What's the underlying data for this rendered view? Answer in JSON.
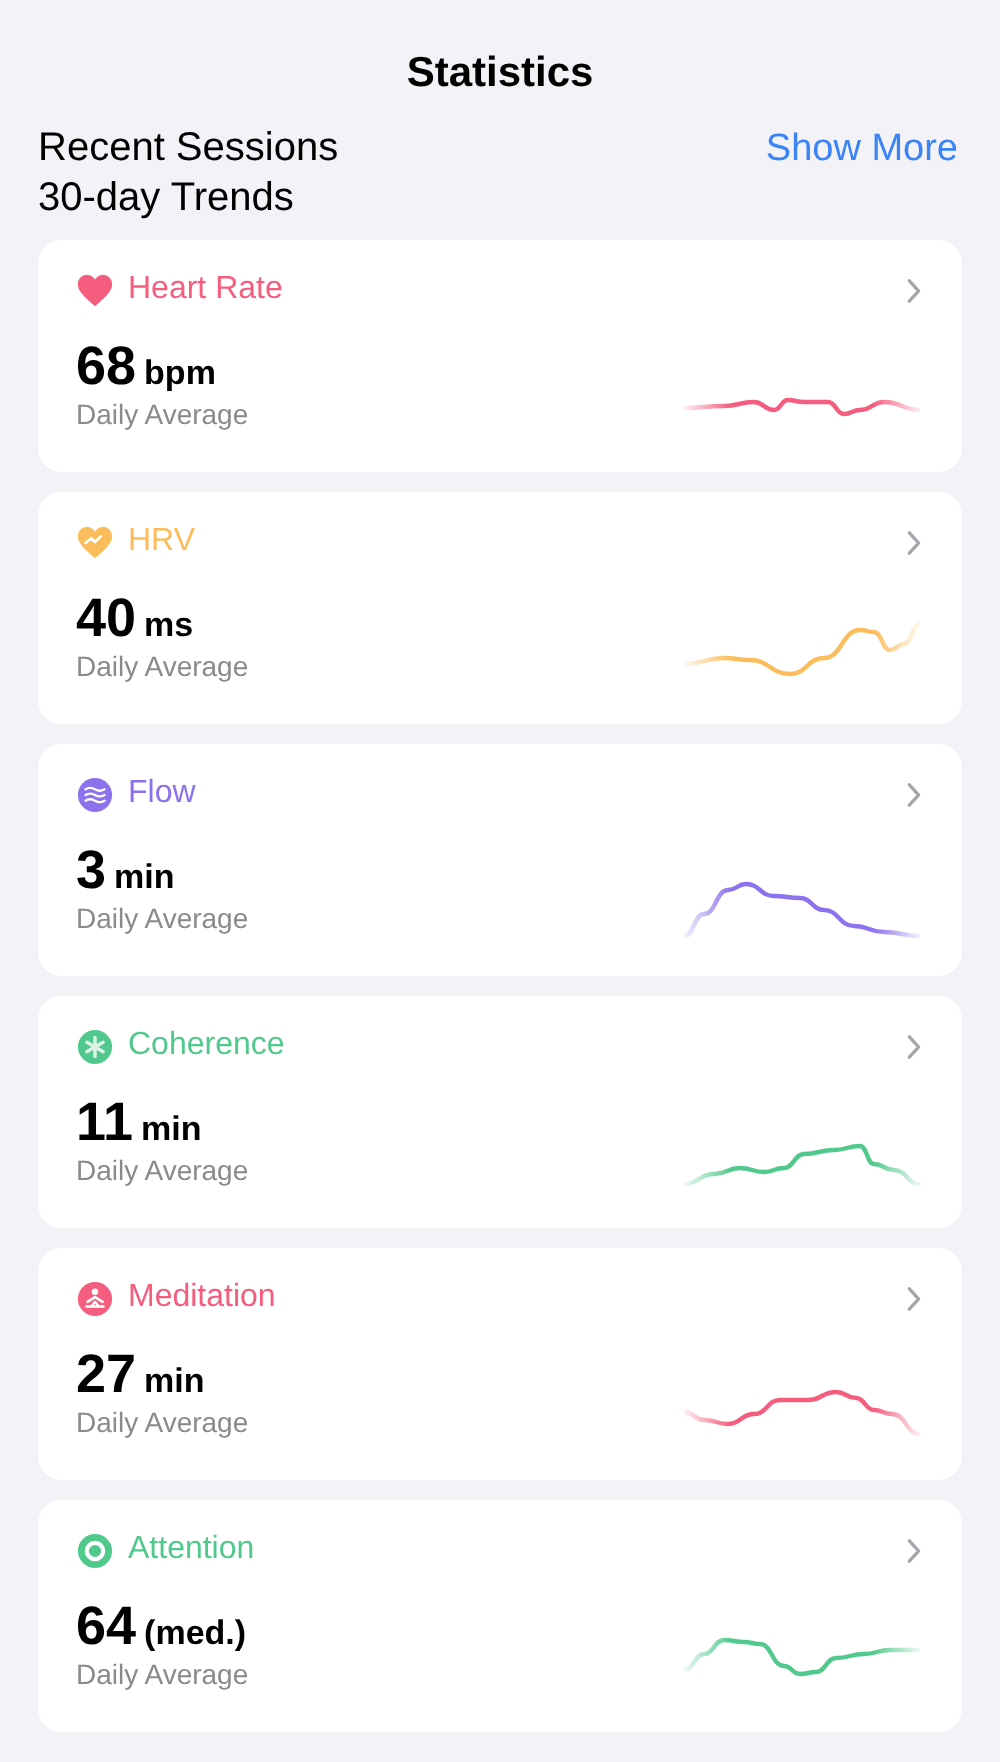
{
  "title": "Statistics",
  "recent_sessions": {
    "heading": "Recent Sessions",
    "link": "Show More"
  },
  "trends_heading": "30-day Trends",
  "cards": [
    {
      "kind": "heart",
      "title": "Heart Rate",
      "color": "#f45d7e",
      "value": "68",
      "unit": "bpm",
      "caption": "Daily Average"
    },
    {
      "kind": "hrv",
      "title": "HRV",
      "color": "#fbbd5c",
      "value": "40",
      "unit": "ms",
      "caption": "Daily Average"
    },
    {
      "kind": "flow",
      "title": "Flow",
      "color": "#8c72ec",
      "value": "3",
      "unit": "min",
      "caption": "Daily Average"
    },
    {
      "kind": "coherence",
      "title": "Coherence",
      "color": "#52c98c",
      "value": "11",
      "unit": "min",
      "caption": "Daily Average"
    },
    {
      "kind": "meditation",
      "title": "Meditation",
      "color": "#f45d7e",
      "value": "27",
      "unit": "min",
      "caption": "Daily Average"
    },
    {
      "kind": "attention",
      "title": "Attention",
      "color": "#52c98c",
      "value": "64",
      "unit": "(med.)",
      "caption": "Daily Average"
    }
  ]
}
